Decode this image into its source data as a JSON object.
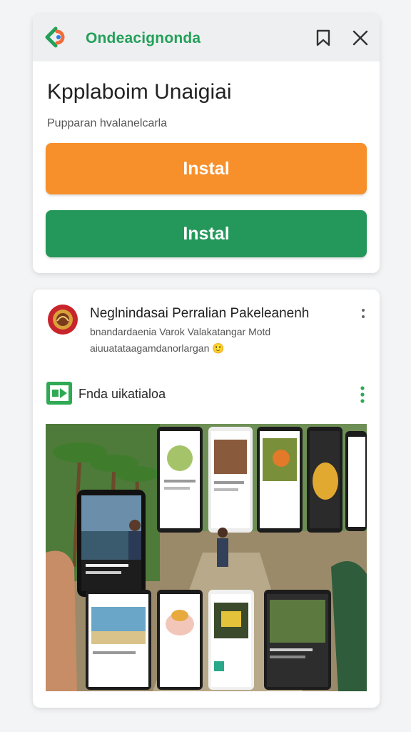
{
  "card1": {
    "brand": "Ondeacignonda",
    "title": "Kpplaboim Unaigiai",
    "subtitle": "Pupparan hvalanelcarla",
    "button_orange": "Instal",
    "button_green": "Instal",
    "icons": {
      "logo": "brand-logo-icon",
      "bookmark": "bookmark-icon",
      "close": "close-icon"
    }
  },
  "card2": {
    "title": "Neglnindasai Perralian Pakeleanenh",
    "line1": "bnandardaenia Varok Valakatangar Motd",
    "line2": "aiuuatataagamdanorlargan",
    "line2_emoji": "🙂",
    "app_label": "Fnda uikatialoa",
    "icons": {
      "avatar": "emblem-avatar-icon",
      "more_small": "more-vertical-icon",
      "app": "app-store-icon",
      "more_green": "more-vertical-icon"
    },
    "image": "collage-image"
  },
  "colors": {
    "orange": "#f7902b",
    "green": "#24985a",
    "brand_green": "#23a05a",
    "background": "#f3f4f5"
  }
}
